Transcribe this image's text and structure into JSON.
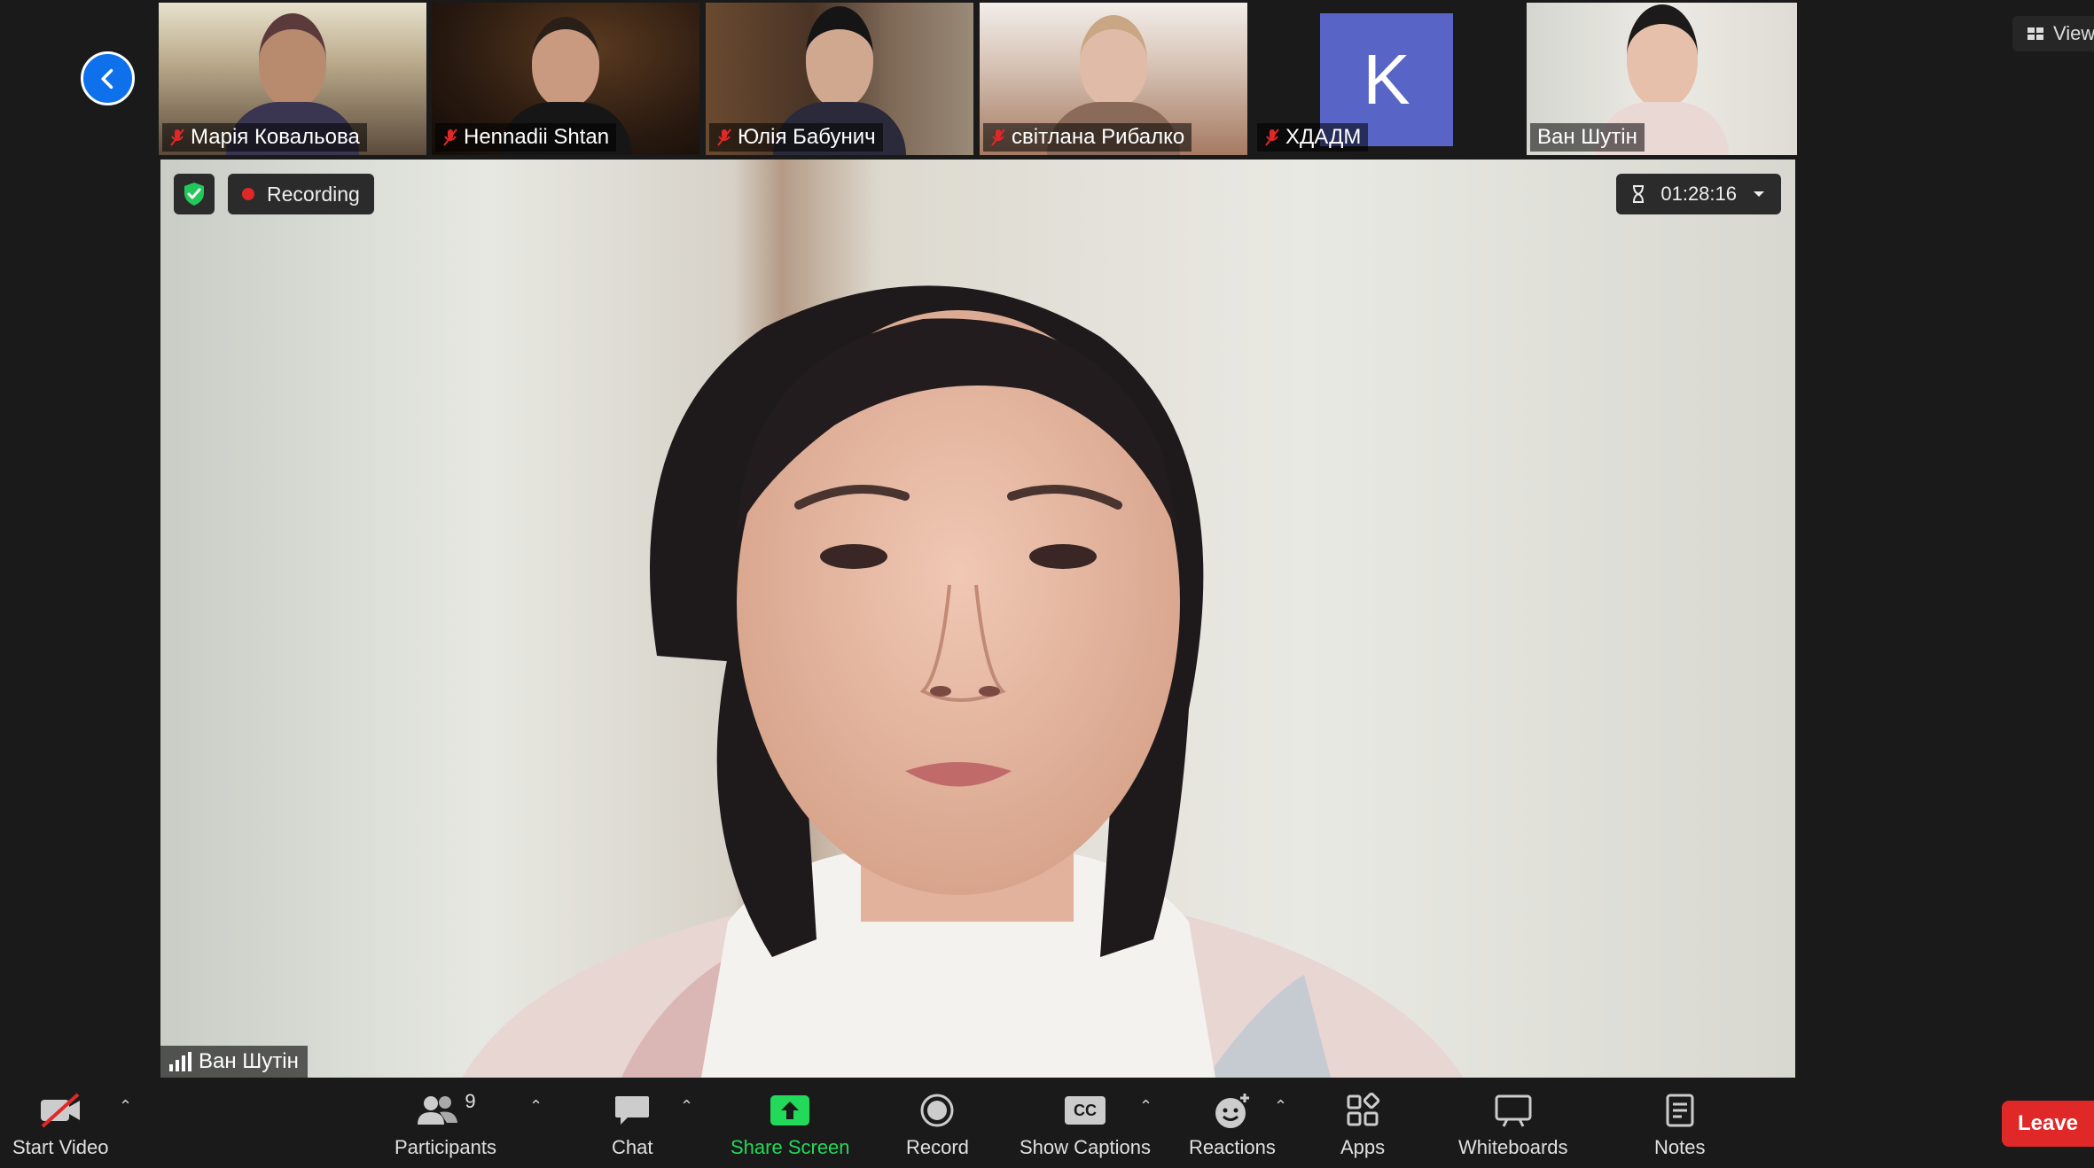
{
  "header": {
    "view_label": "View"
  },
  "participants": [
    {
      "name": "Марія Ковальова",
      "muted": true
    },
    {
      "name": "Hennadii Shtan",
      "muted": true
    },
    {
      "name": "Юлія Бабунич",
      "muted": true
    },
    {
      "name": "світлана Рибалко",
      "muted": true
    },
    {
      "name": "ХДАДМ",
      "muted": true,
      "avatar_letter": "K"
    },
    {
      "name": "Ван Шутін",
      "muted": false,
      "active": true
    }
  ],
  "main": {
    "recording_label": "Recording",
    "timer": "01:28:16",
    "speaker_name": "Ван Шутін"
  },
  "toolbar": {
    "start_video": "Start Video",
    "participants": "Participants",
    "participants_count": "9",
    "chat": "Chat",
    "share_screen": "Share Screen",
    "record": "Record",
    "show_captions": "Show Captions",
    "captions_icon_text": "CC",
    "reactions": "Reactions",
    "apps": "Apps",
    "whiteboards": "Whiteboards",
    "notes": "Notes",
    "leave": "Leave"
  },
  "colors": {
    "accent_blue": "#0e71eb",
    "active_border": "#8bc34a",
    "share_green": "#23d959",
    "leave_red": "#e02828",
    "avatar_purple": "#5865c6"
  }
}
